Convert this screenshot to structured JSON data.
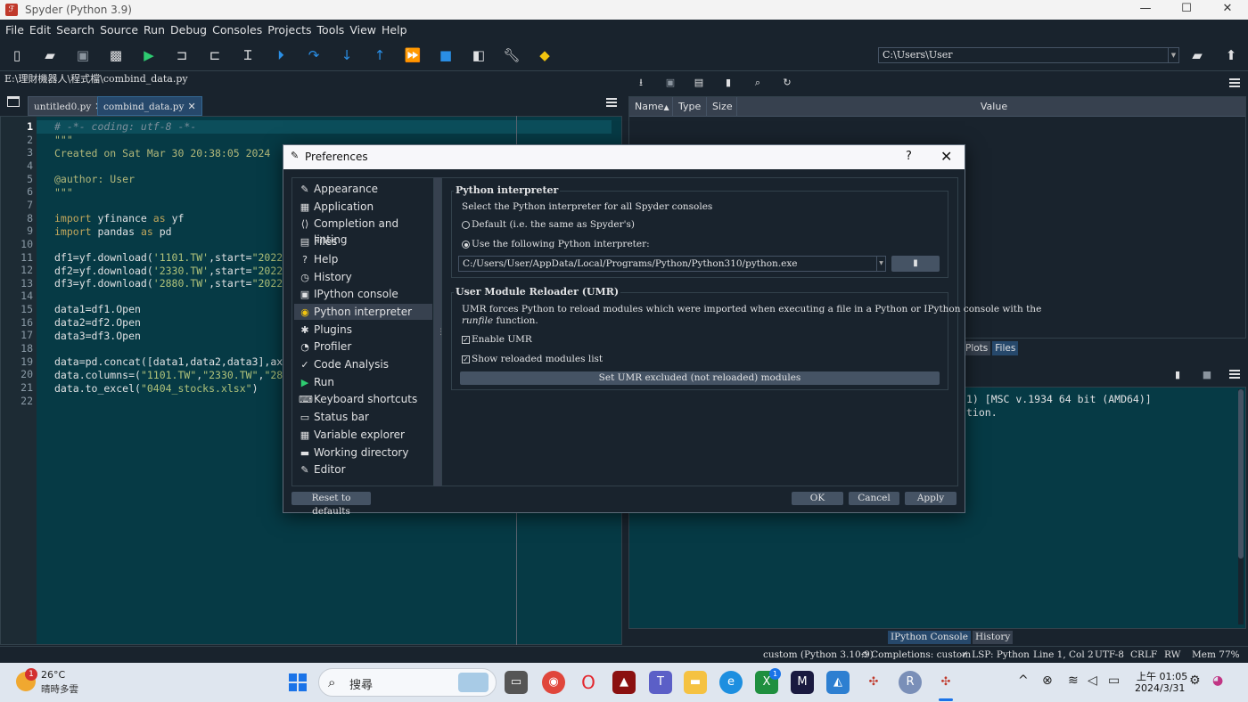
{
  "window": {
    "title": "Spyder (Python 3.9)",
    "app_icon": "spyder-icon",
    "controls": [
      "—",
      "☐",
      "✕"
    ]
  },
  "menu": [
    "File",
    "Edit",
    "Search",
    "Source",
    "Run",
    "Debug",
    "Consoles",
    "Projects",
    "Tools",
    "View",
    "Help"
  ],
  "toolbar": {
    "working_dir": "C:\\Users\\User",
    "icons": [
      "new-file-icon",
      "open-file-icon",
      "save-icon",
      "save-all-icon",
      "run-icon",
      "run-cell-icon",
      "run-cell-advance-icon",
      "run-selection-icon",
      "debug-icon",
      "debug-step-icon",
      "debug-step-into-icon",
      "debug-step-return-icon",
      "debug-continue-icon",
      "debug-stop-icon",
      "maximize-pane-icon",
      "preferences-icon",
      "python-path-icon"
    ]
  },
  "editor": {
    "file_path": "E:\\理財機器人\\程式檔\\combind_data.py",
    "tabs": [
      {
        "label": "untitled0.py",
        "active": false
      },
      {
        "label": "combind_data.py",
        "active": true
      }
    ],
    "line_numbers": [
      "1",
      "2",
      "3",
      "4",
      "5",
      "6",
      "7",
      "8",
      "9",
      "10",
      "11",
      "12",
      "13",
      "14",
      "15",
      "16",
      "17",
      "18",
      "19",
      "20",
      "21",
      "22"
    ],
    "current_line": "1"
  },
  "variable_explorer": {
    "columns": [
      "Name",
      "Type",
      "Size",
      "Value"
    ],
    "sort_indicator": "▲",
    "pane_tabs": [
      "Plots",
      "Files"
    ]
  },
  "console": {
    "lines": [
      "1) [MSC v.1934 64 bit (AMD64)]",
      "tion."
    ],
    "tabs": [
      "IPython Console",
      "History"
    ]
  },
  "statusbar": {
    "interpreter": "custom (Python 3.10.9)",
    "completions": "Completions: custom",
    "lsp": "LSP: Python",
    "position": "Line 1, Col 2",
    "encoding": "UTF-8",
    "eol": "CRLF",
    "permissions": "RW",
    "memory": "Mem 77%"
  },
  "preferences": {
    "title": "Preferences",
    "help": "?",
    "close": "✕",
    "categories": [
      {
        "label": "Appearance",
        "icon": "appearance-icon",
        "glyph": "✎"
      },
      {
        "label": "Application",
        "icon": "application-icon",
        "glyph": "▦"
      },
      {
        "label": "Completion and linting",
        "icon": "completion-icon",
        "glyph": "⟨⟩"
      },
      {
        "label": "Files",
        "icon": "files-icon",
        "glyph": "▤"
      },
      {
        "label": "Help",
        "icon": "help-icon",
        "glyph": "?"
      },
      {
        "label": "History",
        "icon": "history-icon",
        "glyph": "◷"
      },
      {
        "label": "IPython console",
        "icon": "ipython-console-icon",
        "glyph": "▣"
      },
      {
        "label": "Python interpreter",
        "icon": "python-icon",
        "glyph": "◉"
      },
      {
        "label": "Plugins",
        "icon": "plugins-icon",
        "glyph": "✱"
      },
      {
        "label": "Profiler",
        "icon": "profiler-icon",
        "glyph": "◔"
      },
      {
        "label": "Code Analysis",
        "icon": "code-analysis-icon",
        "glyph": "✓"
      },
      {
        "label": "Run",
        "icon": "run-icon",
        "glyph": "▶"
      },
      {
        "label": "Keyboard shortcuts",
        "icon": "keyboard-icon",
        "glyph": "⌨"
      },
      {
        "label": "Status bar",
        "icon": "status-bar-icon",
        "glyph": "▭"
      },
      {
        "label": "Variable explorer",
        "icon": "variable-explorer-icon",
        "glyph": "▦"
      },
      {
        "label": "Working directory",
        "icon": "folder-icon",
        "glyph": "▬"
      },
      {
        "label": "Editor",
        "icon": "editor-icon",
        "glyph": "✎"
      }
    ],
    "selected": "Python interpreter",
    "python_interpreter": {
      "group_title": "Python interpreter",
      "description": "Select the Python interpreter for all Spyder consoles",
      "option_default": "Default (i.e. the same as Spyder's)",
      "option_custom": "Use the following Python interpreter:",
      "selected_option": "custom",
      "interpreter_path": "C:/Users/User/AppData/Local/Programs/Python/Python310/python.exe"
    },
    "umr": {
      "group_title": "User Module Reloader (UMR)",
      "description_1": "UMR forces Python to reload modules which were imported when executing a file in a Python or IPython console with the",
      "description_2_em": "runfile",
      "description_2_rest": " function.",
      "enable_umr": "Enable UMR",
      "enable_umr_checked": true,
      "show_reloaded": "Show reloaded modules list",
      "show_reloaded_checked": true,
      "excluded_button": "Set UMR excluded (not reloaded) modules"
    },
    "buttons": {
      "reset": "Reset to defaults",
      "ok": "OK",
      "cancel": "Cancel",
      "apply": "Apply"
    }
  },
  "taskbar": {
    "weather_temp": "26°C",
    "weather_desc": "晴時多雲",
    "weather_badge": "1",
    "search_text": "搜尋",
    "time": "上午 01:05",
    "date": "2024/3/31",
    "teams_badge": "1",
    "r_app": "R"
  }
}
